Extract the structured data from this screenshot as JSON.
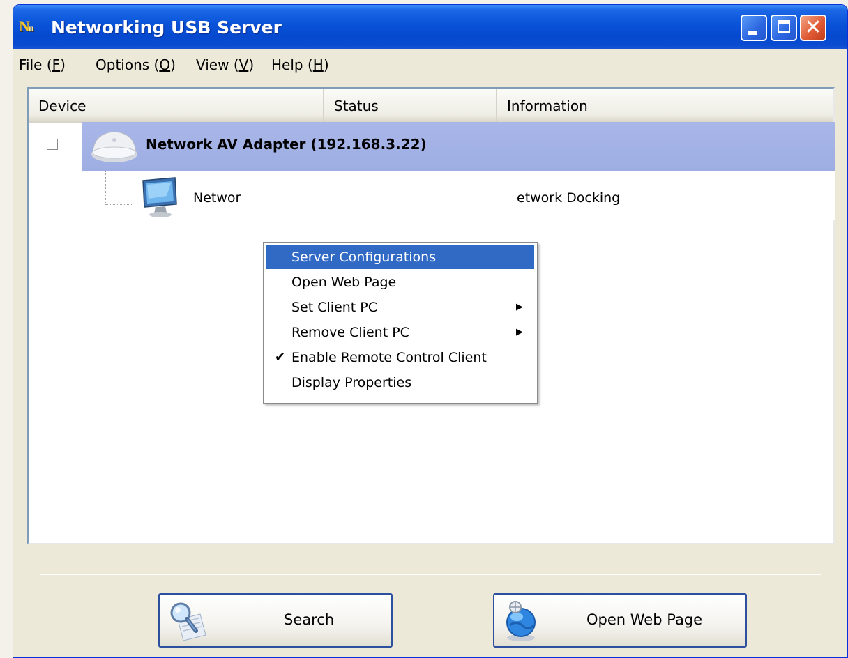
{
  "window": {
    "title": "Networking USB Server",
    "icon_text": "N",
    "icon_sub": "u"
  },
  "menubar": {
    "items": [
      {
        "label": "File (",
        "accel": "F",
        "tail": ")"
      },
      {
        "label": "Options (",
        "accel": "O",
        "tail": ")"
      },
      {
        "label": "View (",
        "accel": "V",
        "tail": ")"
      },
      {
        "label": "Help (",
        "accel": "H",
        "tail": ")"
      }
    ]
  },
  "list": {
    "columns": [
      "Device",
      "Status",
      "Information"
    ],
    "adapter": {
      "label": "Network AV Adapter  (192.168.3.22)"
    },
    "device": {
      "label": "Networ",
      "info": "etwork Docking"
    }
  },
  "context_menu": {
    "items": [
      {
        "label": "Server Configurations",
        "highlighted": true,
        "submenu": false,
        "checked": false
      },
      {
        "label": "Open Web Page",
        "highlighted": false,
        "submenu": false,
        "checked": false
      },
      {
        "label": "Set Client PC",
        "highlighted": false,
        "submenu": true,
        "checked": false
      },
      {
        "label": "Remove Client PC",
        "highlighted": false,
        "submenu": true,
        "checked": false
      },
      {
        "label": "Enable Remote Control Client",
        "highlighted": false,
        "submenu": false,
        "checked": true
      },
      {
        "label": "Display Properties",
        "highlighted": false,
        "submenu": false,
        "checked": false
      }
    ],
    "submenu_glyph": "▶",
    "check_glyph": "✔"
  },
  "buttons": {
    "search": "Search",
    "open_web_page": "Open Web Page"
  },
  "colors": {
    "titlebar": "#0a55d9",
    "selection": "#316ac5",
    "row_highlight": "#a9b6e8",
    "window_bg": "#ece9d8"
  }
}
